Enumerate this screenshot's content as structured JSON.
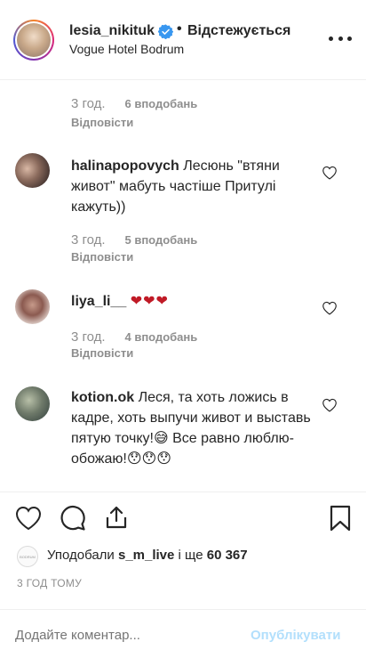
{
  "header": {
    "username": "lesia_nikituk",
    "follow_separator": "•",
    "follow_status": "Відстежується",
    "location": "Vogue Hotel Bodrum"
  },
  "comments": [
    {
      "username": "",
      "text": "",
      "time": "3 год.",
      "likes": "6 вподобань",
      "reply": "Відповісти"
    },
    {
      "username": "halinapopovych",
      "text": "Лесюнь \"втяни живот\" мабуть частіше Притулі кажуть))",
      "time": "3 год.",
      "likes": "5 вподобань",
      "reply": "Відповісти"
    },
    {
      "username": "liya_li__",
      "text": "❤❤❤",
      "time": "3 год.",
      "likes": "4 вподобань",
      "reply": "Відповісти"
    },
    {
      "username": "kotion.ok",
      "text": "Леся, та хоть ложись в кадре, хоть выпучи живот и выставь пятую точку!😅 Все равно люблю-обожаю!😯😯😯"
    }
  ],
  "liked_by": {
    "prefix": "Уподобали",
    "user": "s_m_live",
    "middle": "і ще",
    "count": "60 367",
    "avatar_text": "BODRUM"
  },
  "posted": "3 ГОД ТОМУ",
  "add_comment": {
    "placeholder": "Додайте коментар...",
    "post_label": "Опублікувати"
  },
  "colors": {
    "verified": "#3897f0",
    "post_disabled": "#b2dffc",
    "heart_red": "#c01a26"
  }
}
